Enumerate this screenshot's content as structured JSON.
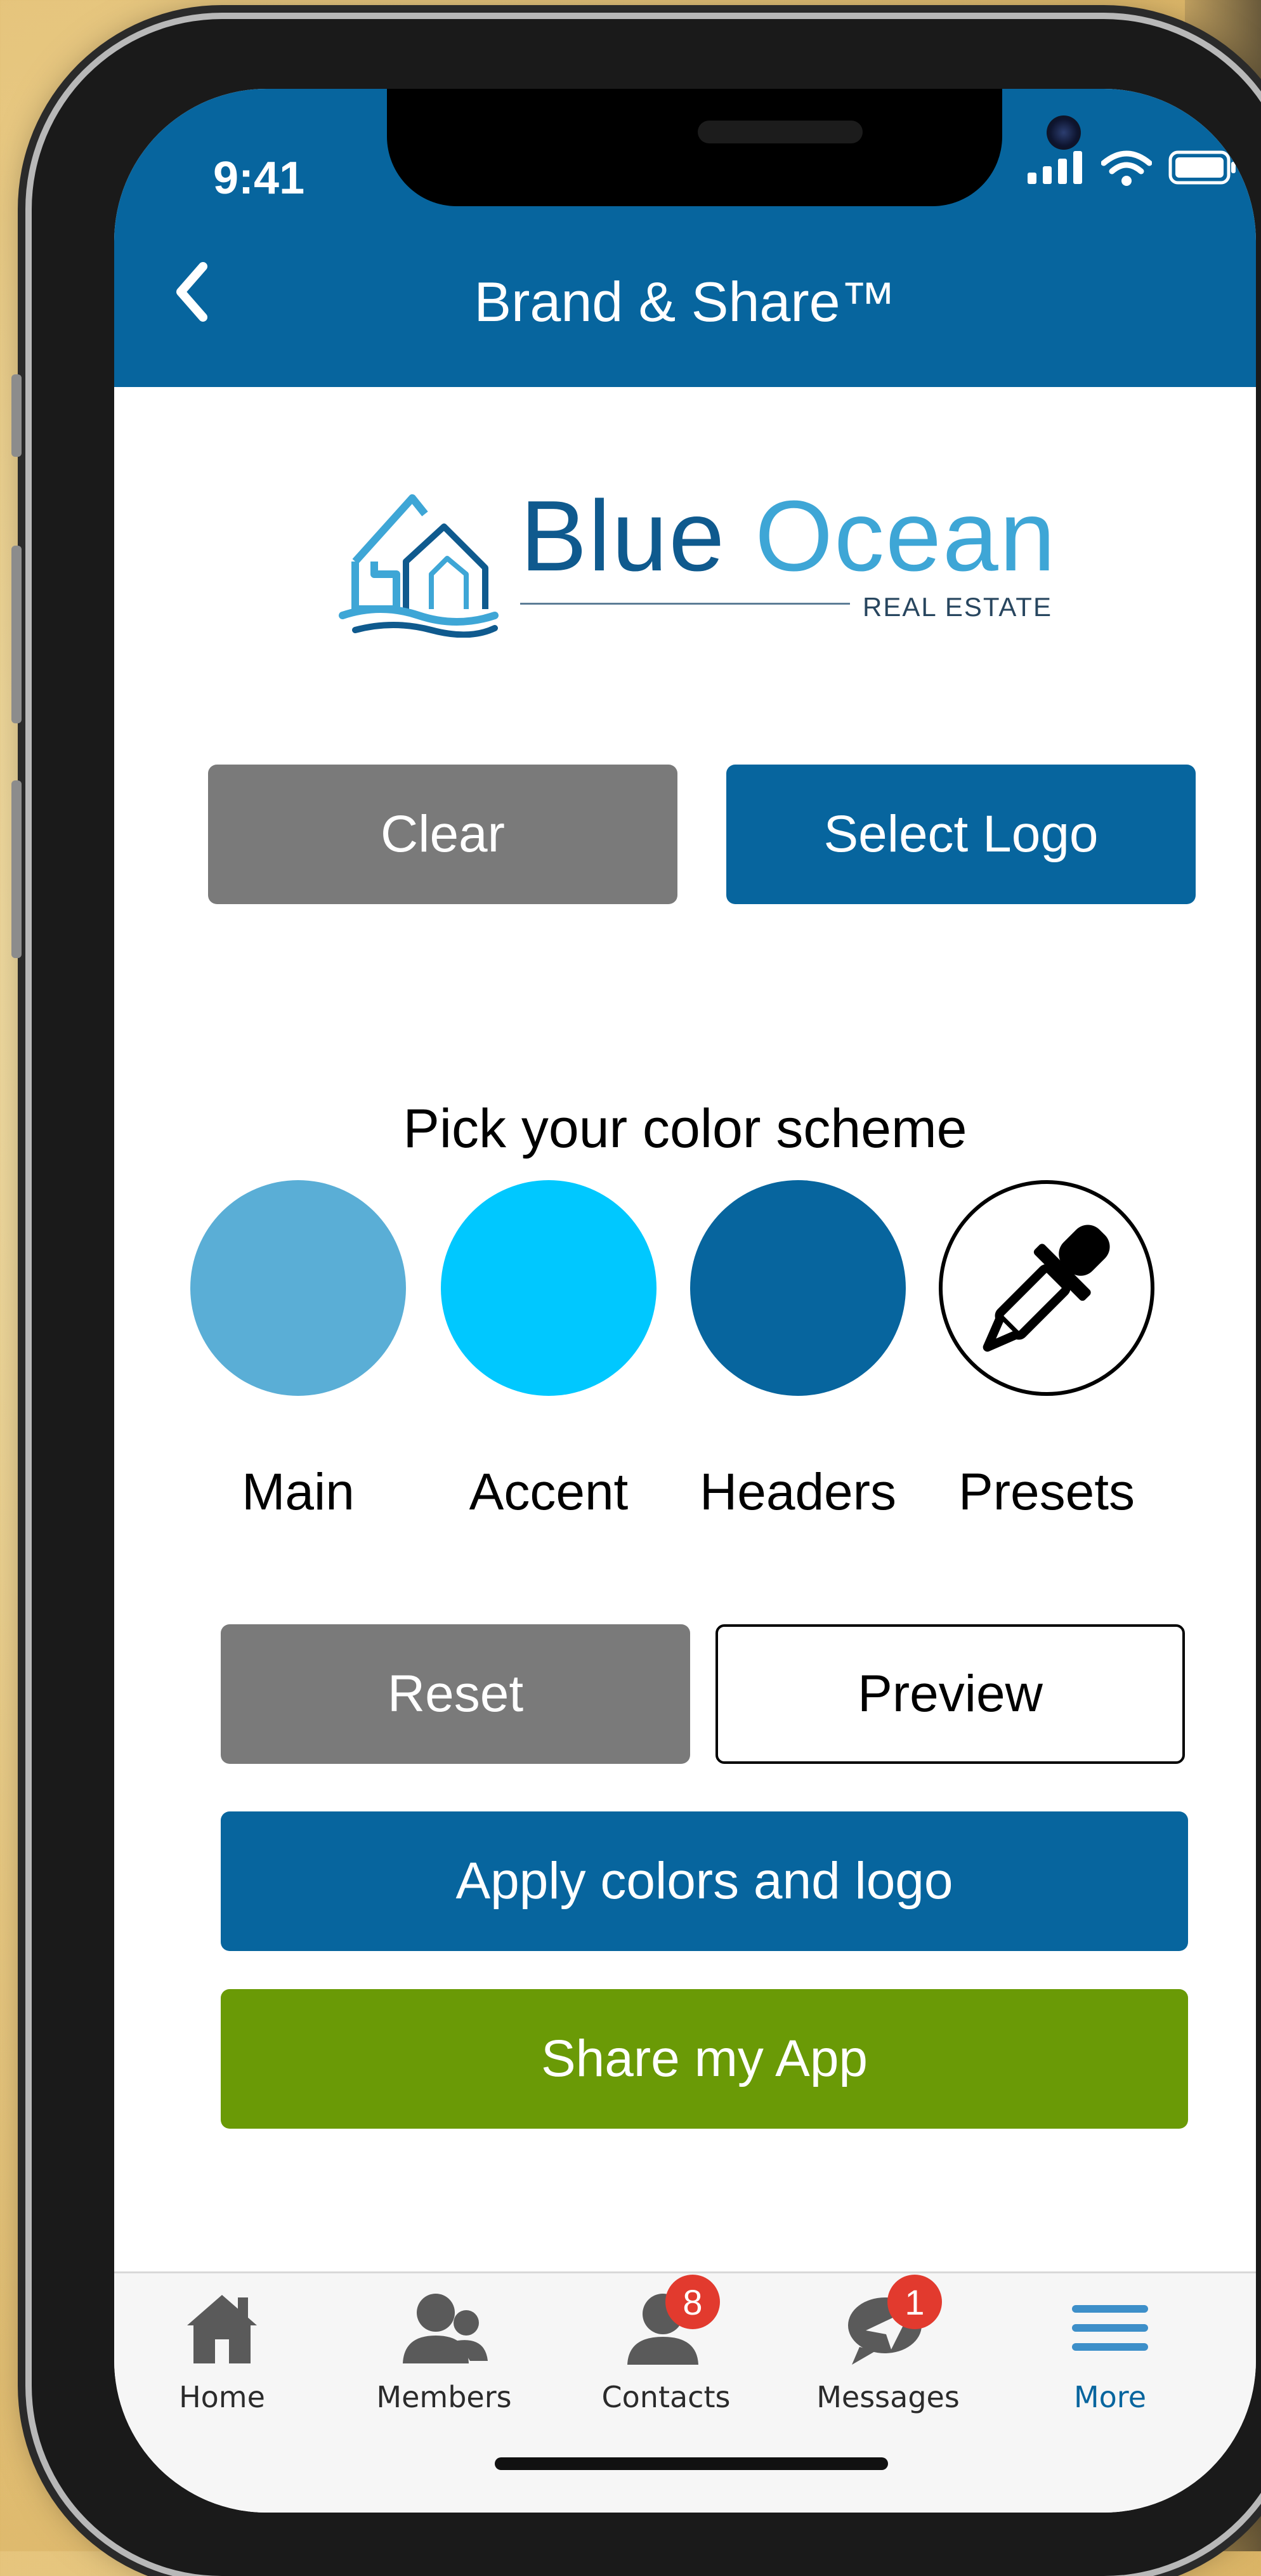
{
  "status_bar": {
    "time": "9:41"
  },
  "header": {
    "title": "Brand & Share™"
  },
  "logo": {
    "name_part1": "Blue",
    "name_part2": "Ocean",
    "subtitle": "REAL ESTATE"
  },
  "logo_actions": {
    "clear_label": "Clear",
    "select_logo_label": "Select Logo"
  },
  "color_scheme": {
    "heading": "Pick your color scheme",
    "swatches": [
      {
        "label": "Main",
        "color": "#5aaed6"
      },
      {
        "label": "Accent",
        "color": "#00c8ff"
      },
      {
        "label": "Headers",
        "color": "#07659e"
      },
      {
        "label": "Presets",
        "icon": "eyedropper-icon"
      }
    ]
  },
  "actions": {
    "reset_label": "Reset",
    "preview_label": "Preview",
    "apply_label": "Apply colors and logo",
    "share_label": "Share my App"
  },
  "tabbar": {
    "items": [
      {
        "label": "Home",
        "icon": "home-icon"
      },
      {
        "label": "Members",
        "icon": "members-icon"
      },
      {
        "label": "Contacts",
        "icon": "contacts-icon",
        "badge": "8"
      },
      {
        "label": "Messages",
        "icon": "messages-icon",
        "badge": "1"
      },
      {
        "label": "More",
        "icon": "menu-icon",
        "active": true
      }
    ]
  },
  "colors": {
    "primary": "#07659e",
    "gray_button": "#7a7a7a",
    "share_green": "#6a9a06",
    "badge_red": "#e23a2e"
  }
}
